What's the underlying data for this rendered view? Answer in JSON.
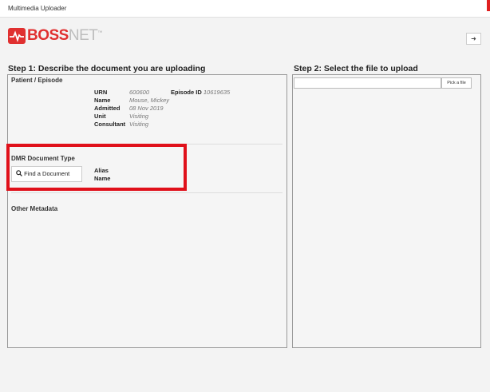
{
  "window": {
    "title": "Multimedia Uploader"
  },
  "header": {
    "logo_main": "BOSS",
    "logo_net": "NET",
    "logo_tm": "™",
    "exit_icon": "exit-icon"
  },
  "step1": {
    "title": "Step 1: Describe the document you are uploading",
    "patient_section": "Patient / Episode",
    "fields": {
      "urn_label": "URN",
      "urn_value": "600600",
      "episode_label": "Episode ID",
      "episode_value": "10619635",
      "name_label": "Name",
      "name_value": "Mouse, Mickey",
      "admitted_label": "Admitted",
      "admitted_value": "08 Nov 2019",
      "unit_label": "Unit",
      "unit_value": "Visiting",
      "consultant_label": "Consultant",
      "consultant_value": "Visiting"
    },
    "dmr_section": "DMR Document Type",
    "find_button": "Find a Document",
    "alias_label": "Alias",
    "name_label": "Name",
    "other_section": "Other Metadata"
  },
  "step2": {
    "title": "Step 2: Select the file to upload",
    "file_value": "",
    "pick_button": "Pick a file"
  },
  "colors": {
    "accent_red": "#e0101a",
    "logo_red": "#e03030"
  }
}
